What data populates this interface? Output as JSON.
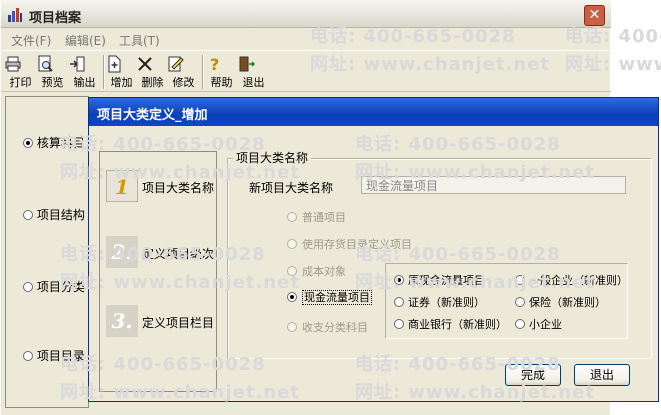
{
  "main_window": {
    "title": "项目档案",
    "close_glyph": "✕",
    "menu": [
      "文件(F)",
      "编辑(E)",
      "工具(T)"
    ],
    "toolbar": {
      "print": "打印",
      "preview": "预览",
      "export": "输出",
      "add": "增加",
      "delete": "删除",
      "modify": "修改",
      "help": "帮助",
      "exit": "退出"
    },
    "left_options": [
      {
        "label": "核算科目",
        "selected": true
      },
      {
        "label": "项目结构",
        "selected": false
      },
      {
        "label": "项目分类",
        "selected": false
      },
      {
        "label": "项目目录",
        "selected": false
      }
    ]
  },
  "dialog": {
    "title": "项目大类定义_增加",
    "steps": [
      {
        "number": "1",
        "label": "项目大类名称",
        "active": true
      },
      {
        "number": "2.",
        "label": "定义项目级次",
        "active": false
      },
      {
        "number": "3.",
        "label": "定义项目栏目",
        "active": false
      }
    ],
    "group_label": "项目大类名称",
    "name_field": {
      "label": "新项目大类名称",
      "value": "现金流量项目"
    },
    "type_options": [
      {
        "label": "普通项目",
        "selected": false,
        "enabled": false
      },
      {
        "label": "使用存货目录定义项目",
        "selected": false,
        "enabled": false
      },
      {
        "label": "成本对象",
        "selected": false,
        "enabled": false
      },
      {
        "label": "现金流量项目",
        "selected": true,
        "enabled": true
      },
      {
        "label": "收支分类科目",
        "selected": false,
        "enabled": false
      }
    ],
    "subtype_options": [
      {
        "label": "原现金流量项目",
        "selected": true
      },
      {
        "label": "一般企业（新准则）",
        "selected": false
      },
      {
        "label": "证券（新准则）",
        "selected": false
      },
      {
        "label": "保险（新准则）",
        "selected": false
      },
      {
        "label": "商业银行（新准则）",
        "selected": false
      },
      {
        "label": "小企业",
        "selected": false
      }
    ],
    "buttons": {
      "finish": "完成",
      "exit": "退出"
    }
  },
  "watermark": {
    "phone": "电话: 400-665-0028",
    "site": "网址: www.chanjet.net"
  },
  "colors": {
    "dialog_title_bg": "#0a3fb8",
    "window_bg": "#ece9d8",
    "close_button": "#c95f45"
  }
}
